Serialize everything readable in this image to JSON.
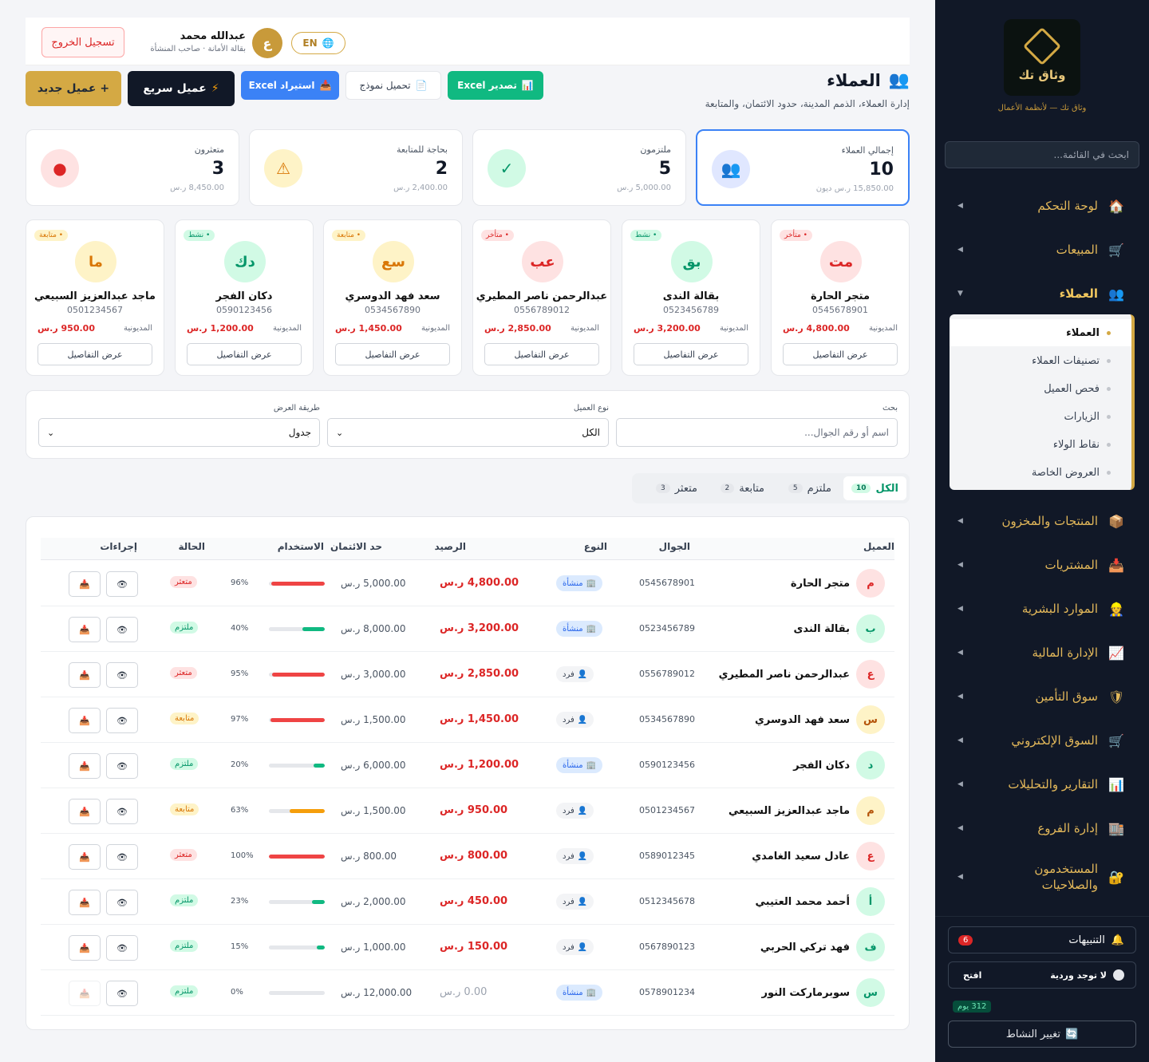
{
  "sidebar": {
    "logo_name": "وثاق تك",
    "tagline": "وثاق تك — لأنظمة الأعمال",
    "search_placeholder": "ابحث في القائمة...",
    "items": [
      {
        "label": "لوحة التحكم",
        "icon": "home-icon",
        "glyph": "🏠"
      },
      {
        "label": "المبيعات",
        "icon": "cart-icon",
        "glyph": "🛒"
      },
      {
        "label": "العملاء",
        "icon": "users-icon",
        "glyph": "👥"
      },
      {
        "label": "المنتجات والمخزون",
        "icon": "box-icon",
        "glyph": "📦"
      },
      {
        "label": "المشتريات",
        "icon": "inbox-icon",
        "glyph": "📥"
      },
      {
        "label": "الموارد البشرية",
        "icon": "person-icon",
        "glyph": "👷"
      },
      {
        "label": "الإدارة المالية",
        "icon": "chart-icon",
        "glyph": "📈"
      },
      {
        "label": "سوق التأمين",
        "icon": "shield-icon",
        "glyph": "🛡"
      },
      {
        "label": "السوق الإلكتروني",
        "icon": "cart-icon",
        "glyph": "🛒"
      },
      {
        "label": "التقارير والتحليلات",
        "icon": "bar-chart-icon",
        "glyph": "📊"
      },
      {
        "label": "إدارة الفروع",
        "icon": "building-icon",
        "glyph": "🏬"
      },
      {
        "label": "المستخدمون والصلاحيات",
        "icon": "lock-icon",
        "glyph": "🔐"
      }
    ],
    "submenu": [
      "العملاء",
      "تصنيفات العملاء",
      "فحص العميل",
      "الزيارات",
      "نقاط الولاء",
      "العروض الخاصة"
    ],
    "notifications_label": "التنبيهات",
    "notifications_count": "6",
    "shift_label": "لا توجد وردية",
    "shift_open": "افتح",
    "days": "312 يوم",
    "change_activity": "تغيير النشاط"
  },
  "header": {
    "logout": "تسجيل الخروج",
    "user_name": "عبدالله محمد",
    "user_sub": "بقالة الأمانة · صاحب المنشأة",
    "avatar_letter": "ع",
    "lang": "EN"
  },
  "page": {
    "title": "العملاء",
    "subtitle": "إدارة العملاء، الذمم المدينة، حدود الائتمان، والمتابعة",
    "btn_new": "+ عميل جديد",
    "btn_quick": "عميل سريع",
    "btn_import": "استيراد Excel",
    "btn_template": "تحميل نموذج",
    "btn_export": "تصدير Excel"
  },
  "stats": [
    {
      "label": "إجمالي العملاء",
      "value": "10",
      "amount": "15,850.00 ر.س ديون"
    },
    {
      "label": "ملتزمون",
      "value": "5",
      "amount": "5,000.00 ر.س"
    },
    {
      "label": "بحاجة للمتابعة",
      "value": "2",
      "amount": "2,400.00 ر.س"
    },
    {
      "label": "متعثرون",
      "value": "3",
      "amount": "8,450.00 ر.س"
    }
  ],
  "cards": [
    {
      "badge": "• متأخر",
      "kind": "late",
      "initials": "مت",
      "name": "متجر الحارة",
      "phone": "0545678901",
      "debt_label": "المديونية",
      "debt": "4,800.00 ر.س",
      "details": "عرض التفاصيل"
    },
    {
      "badge": "• نشط",
      "kind": "act",
      "initials": "بق",
      "name": "بقالة الندى",
      "phone": "0523456789",
      "debt_label": "المديونية",
      "debt": "3,200.00 ر.س",
      "details": "عرض التفاصيل"
    },
    {
      "badge": "• متأخر",
      "kind": "late",
      "initials": "عب",
      "name": "عبدالرحمن ناصر المطيري",
      "phone": "0556789012",
      "debt_label": "المديونية",
      "debt": "2,850.00 ر.س",
      "details": "عرض التفاصيل"
    },
    {
      "badge": "• متابعة",
      "kind": "fol",
      "initials": "سع",
      "name": "سعد فهد الدوسري",
      "phone": "0534567890",
      "debt_label": "المديونية",
      "debt": "1,450.00 ر.س",
      "details": "عرض التفاصيل"
    },
    {
      "badge": "• نشط",
      "kind": "act",
      "initials": "دك",
      "name": "دكان الفجر",
      "phone": "0590123456",
      "debt_label": "المديونية",
      "debt": "1,200.00 ر.س",
      "details": "عرض التفاصيل"
    },
    {
      "badge": "• متابعة",
      "kind": "fol",
      "initials": "ما",
      "name": "ماجد عبدالعزيز السبيعي",
      "phone": "0501234567",
      "debt_label": "المديونية",
      "debt": "950.00 ر.س",
      "details": "عرض التفاصيل"
    }
  ],
  "filters": {
    "search_label": "بحث",
    "search_placeholder": "اسم أو رقم الجوال...",
    "type_label": "نوع العميل",
    "type_value": "الكل",
    "view_label": "طريقة العرض",
    "view_value": "جدول"
  },
  "tabs": [
    {
      "label": "الكل",
      "count": "10"
    },
    {
      "label": "ملتزم",
      "count": "5"
    },
    {
      "label": "متابعة",
      "count": "2"
    },
    {
      "label": "متعثر",
      "count": "3"
    }
  ],
  "table": {
    "headers": [
      "العميل",
      "الجوال",
      "النوع",
      "الرصيد",
      "حد الائتمان",
      "الاستخدام",
      "الحالة",
      "إجراءات"
    ],
    "rows": [
      {
        "letter": "م",
        "name": "متجر الحارة",
        "phone": "0545678901",
        "type": "منشأة",
        "org": true,
        "balance": "4,800.00 ر.س",
        "limit": "5,000.00 ر.س",
        "usage": 96,
        "pct": "96%",
        "status": "متعثر",
        "st": "late"
      },
      {
        "letter": "ب",
        "name": "بقالة الندى",
        "phone": "0523456789",
        "type": "منشأة",
        "org": true,
        "balance": "3,200.00 ر.س",
        "limit": "8,000.00 ر.س",
        "usage": 40,
        "pct": "40%",
        "status": "ملتزم",
        "st": "ok"
      },
      {
        "letter": "ع",
        "name": "عبدالرحمن ناصر المطيري",
        "phone": "0556789012",
        "type": "فرد",
        "org": false,
        "balance": "2,850.00 ر.س",
        "limit": "3,000.00 ر.س",
        "usage": 95,
        "pct": "95%",
        "status": "متعثر",
        "st": "late"
      },
      {
        "letter": "س",
        "name": "سعد فهد الدوسري",
        "phone": "0534567890",
        "type": "فرد",
        "org": false,
        "balance": "1,450.00 ر.س",
        "limit": "1,500.00 ر.س",
        "usage": 97,
        "pct": "97%",
        "status": "متابعة",
        "st": "fol"
      },
      {
        "letter": "د",
        "name": "دكان الفجر",
        "phone": "0590123456",
        "type": "منشأة",
        "org": true,
        "balance": "1,200.00 ر.س",
        "limit": "6,000.00 ر.س",
        "usage": 20,
        "pct": "20%",
        "status": "ملتزم",
        "st": "ok"
      },
      {
        "letter": "م",
        "name": "ماجد عبدالعزيز السبيعي",
        "phone": "0501234567",
        "type": "فرد",
        "org": false,
        "balance": "950.00 ر.س",
        "limit": "1,500.00 ر.س",
        "usage": 63,
        "pct": "63%",
        "status": "متابعة",
        "st": "fol"
      },
      {
        "letter": "ع",
        "name": "عادل سعيد الغامدي",
        "phone": "0589012345",
        "type": "فرد",
        "org": false,
        "balance": "800.00 ر.س",
        "limit": "800.00 ر.س",
        "usage": 100,
        "pct": "100%",
        "status": "متعثر",
        "st": "late"
      },
      {
        "letter": "أ",
        "name": "أحمد محمد العتيبي",
        "phone": "0512345678",
        "type": "فرد",
        "org": false,
        "balance": "450.00 ر.س",
        "limit": "2,000.00 ر.س",
        "usage": 23,
        "pct": "23%",
        "status": "ملتزم",
        "st": "ok"
      },
      {
        "letter": "ف",
        "name": "فهد تركي الحربي",
        "phone": "0567890123",
        "type": "فرد",
        "org": false,
        "balance": "150.00 ر.س",
        "limit": "1,000.00 ر.س",
        "usage": 15,
        "pct": "15%",
        "status": "ملتزم",
        "st": "ok"
      },
      {
        "letter": "س",
        "name": "سوبرماركت النور",
        "phone": "0578901234",
        "type": "منشأة",
        "org": true,
        "balance": "0.00 ر.س",
        "limit": "12,000.00 ر.س",
        "usage": 0,
        "pct": "0%",
        "status": "ملتزم",
        "st": "ok"
      }
    ]
  },
  "colors": {
    "gold": "#d4a944",
    "navy": "#111827",
    "red": "#dc2626",
    "green": "#10b981",
    "amber": "#f59e0b",
    "blue": "#3b82f6"
  }
}
